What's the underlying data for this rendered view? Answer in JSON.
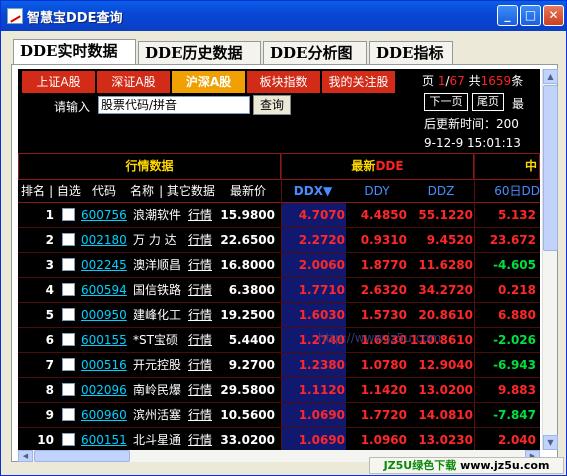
{
  "window": {
    "title": "智慧宝DDE查询",
    "min_glyph": "_",
    "max_glyph": "□",
    "close_glyph": "✕"
  },
  "main_tabs": [
    "DDE实时数据",
    "DDE历史数据",
    "DDE分析图",
    "DDE指标"
  ],
  "market_tabs": [
    "上证A股",
    "深证A股",
    "沪深A股",
    "板块指数",
    "我的关注股"
  ],
  "page": {
    "prefix": "页",
    "current": "1",
    "sep": "/",
    "total_pages": "67",
    "total_label": "共",
    "total_count": "1659",
    "unit": "条"
  },
  "nav": {
    "next": "下一页",
    "last": "尾页",
    "tail": "最"
  },
  "update": {
    "label": "后更新时间：",
    "value": "200",
    "timestamp": "9-12-9 15:01:13"
  },
  "search": {
    "label": "请输入",
    "placeholder": "股票代码/拼音",
    "button": "查询"
  },
  "groups": {
    "market": "行情数据",
    "latest": "最新",
    "latest_dde": "DDE",
    "mid": "中"
  },
  "columns": {
    "rank": "排名",
    "select": "| 自选",
    "code": "代码",
    "name": "名称",
    "other": "| 其它数据",
    "price": "最新价",
    "ddx": "DDX▼",
    "ddy": "DDY",
    "ddz": "DDZ",
    "d60": "60日DD"
  },
  "rows": [
    {
      "idx": "1",
      "code": "600756",
      "name": "浪潮软件",
      "hq": "行情",
      "price": "15.9800",
      "ddx": "4.7070",
      "ddy": "4.4850",
      "ddz": "55.1220",
      "d60": "5.132"
    },
    {
      "idx": "2",
      "code": "002180",
      "name": "万 力 达",
      "hq": "行情",
      "price": "22.6500",
      "ddx": "2.2720",
      "ddy": "0.9310",
      "ddz": "9.4520",
      "d60": "23.672"
    },
    {
      "idx": "3",
      "code": "002245",
      "name": "澳洋顺昌",
      "hq": "行情",
      "price": "16.8000",
      "ddx": "2.0060",
      "ddy": "1.8770",
      "ddz": "11.6280",
      "d60": "-4.605",
      "neg": true
    },
    {
      "idx": "4",
      "code": "600594",
      "name": "国信铁路",
      "hq": "行情",
      "price": "6.3800",
      "ddx": "1.7710",
      "ddy": "2.6320",
      "ddz": "34.2720",
      "d60": "0.218"
    },
    {
      "idx": "5",
      "code": "000950",
      "name": "建峰化工",
      "hq": "行情",
      "price": "19.2500",
      "ddx": "1.6030",
      "ddy": "1.5730",
      "ddz": "20.8610",
      "d60": "6.880"
    },
    {
      "idx": "6",
      "code": "600155",
      "name": "*ST宝硕",
      "hq": "行情",
      "price": "5.4400",
      "ddx": "1.2740",
      "ddy": "1.6930",
      "ddz": "110.8610",
      "d60": "-2.026",
      "neg": true
    },
    {
      "idx": "7",
      "code": "000516",
      "name": "开元控股",
      "hq": "行情",
      "price": "9.2700",
      "ddx": "1.2380",
      "ddy": "1.0780",
      "ddz": "12.9040",
      "d60": "-6.943",
      "neg": true
    },
    {
      "idx": "8",
      "code": "002096",
      "name": "南岭民爆",
      "hq": "行情",
      "price": "29.5800",
      "ddx": "1.1120",
      "ddy": "1.1420",
      "ddz": "13.0200",
      "d60": "9.883"
    },
    {
      "idx": "9",
      "code": "600960",
      "name": "滨州活塞",
      "hq": "行情",
      "price": "10.5600",
      "ddx": "1.0690",
      "ddy": "1.7720",
      "ddz": "14.0810",
      "d60": "-7.847",
      "neg": true
    },
    {
      "idx": "10",
      "code": "600151",
      "name": "北斗星通",
      "hq": "行情",
      "price": "33.0200",
      "ddx": "1.0690",
      "ddy": "1.0960",
      "ddz": "13.0230",
      "d60": "2.040"
    }
  ],
  "watermark": "http://www.jz5u.com",
  "footer": {
    "green": "JZ5U绿色下载",
    "url": "www.jz5u.com"
  },
  "colors": {
    "title_blue": "#0a5fe6",
    "tab_red": "#d22c18",
    "tab_active": "#f0a000",
    "up_red": "#ff2828",
    "down_green": "#00e040",
    "code_cyan": "#00d0ff",
    "ddx_band": "#101870"
  }
}
